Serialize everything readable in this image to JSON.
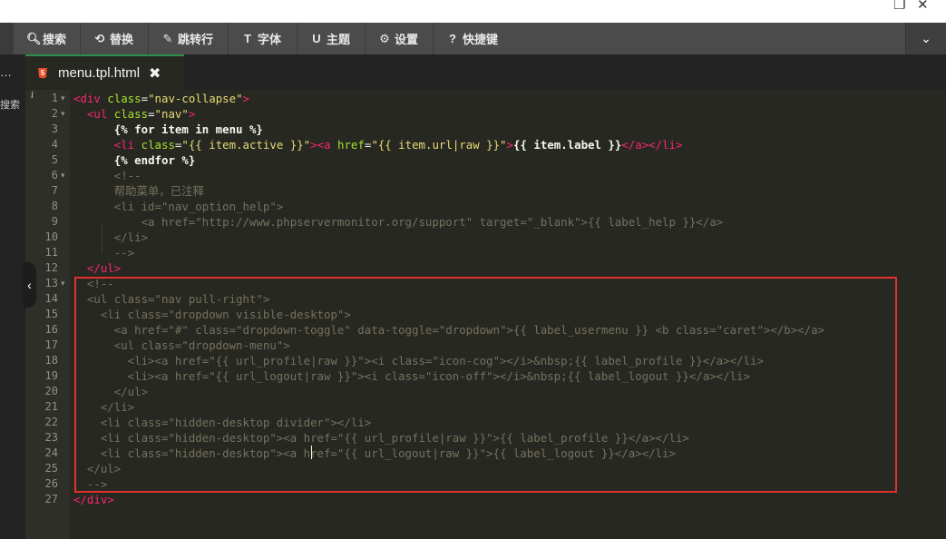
{
  "window": {
    "restore_icon": "restore-icon",
    "close_icon": "close-icon",
    "restore_glyph": "❐",
    "close_glyph": "✕"
  },
  "toolbar": {
    "items": [
      {
        "label": "搜索",
        "icon": "search-icon",
        "glyph": "🔍︎"
      },
      {
        "label": "替换",
        "icon": "replace-icon",
        "glyph": "⟲"
      },
      {
        "label": "跳转行",
        "icon": "pin-icon",
        "glyph": "✎"
      },
      {
        "label": "字体",
        "icon": "text-icon",
        "glyph": "T"
      },
      {
        "label": "主题",
        "icon": "magnet-icon",
        "glyph": "U"
      },
      {
        "label": "设置",
        "icon": "gear-icon",
        "glyph": "⚙"
      },
      {
        "label": "快捷键",
        "icon": "help-icon",
        "glyph": "?"
      }
    ],
    "collapse_glyph": "⌄"
  },
  "sidebar": {
    "dots": "…",
    "label": "搜索"
  },
  "tab": {
    "name": "menu.tpl.html",
    "close": "✖",
    "file_type_icon": "html5-icon"
  },
  "gutter": {
    "info": "i",
    "line_numbers": [
      "1",
      "2",
      "3",
      "4",
      "5",
      "6",
      "7",
      "8",
      "9",
      "10",
      "11",
      "12",
      "13",
      "14",
      "15",
      "16",
      "17",
      "18",
      "19",
      "20",
      "21",
      "22",
      "23",
      "24",
      "25",
      "26",
      "27"
    ],
    "fold_lines": [
      "1",
      "2",
      "6",
      "13"
    ]
  },
  "code": [
    [
      [
        "t",
        "<div "
      ],
      [
        "a",
        "class"
      ],
      [
        "p",
        "="
      ],
      [
        "s",
        "\"nav-collapse\""
      ],
      [
        "t",
        ">"
      ]
    ],
    [
      [
        "p",
        "  "
      ],
      [
        "t",
        "<ul "
      ],
      [
        "a",
        "class"
      ],
      [
        "p",
        "="
      ],
      [
        "s",
        "\"nav\""
      ],
      [
        "t",
        ">"
      ]
    ],
    [
      [
        "p",
        "      "
      ],
      [
        "tpl",
        "{% for item in menu %}"
      ]
    ],
    [
      [
        "p",
        "      "
      ],
      [
        "t",
        "<li "
      ],
      [
        "a",
        "class"
      ],
      [
        "p",
        "="
      ],
      [
        "s",
        "\"{{ item.active }}\""
      ],
      [
        "t",
        ">"
      ],
      [
        "t",
        "<a "
      ],
      [
        "a",
        "href"
      ],
      [
        "p",
        "="
      ],
      [
        "s",
        "\"{{ item.url|raw }}\""
      ],
      [
        "t",
        ">"
      ],
      [
        "tpl",
        "{{ item.label }}"
      ],
      [
        "t",
        "</a></li>"
      ]
    ],
    [
      [
        "p",
        "      "
      ],
      [
        "tpl",
        "{% endfor %}"
      ]
    ],
    [
      [
        "c",
        "      <!--"
      ]
    ],
    [
      [
        "c",
        "      帮助菜单，已注释"
      ]
    ],
    [
      [
        "c",
        "      <li id=\"nav_option_help\">"
      ]
    ],
    [
      [
        "c",
        "          <a href=\"http://www.phpservermonitor.org/support\" target=\"_blank\">{{ label_help }}</a>"
      ]
    ],
    [
      [
        "c",
        "      </li>"
      ]
    ],
    [
      [
        "c",
        "      -->"
      ]
    ],
    [
      [
        "p",
        "  "
      ],
      [
        "t",
        "</ul>"
      ]
    ],
    [
      [
        "c",
        "  <!--"
      ]
    ],
    [
      [
        "c",
        "  <ul class=\"nav pull-right\">"
      ]
    ],
    [
      [
        "c",
        "    <li class=\"dropdown visible-desktop\">"
      ]
    ],
    [
      [
        "c",
        "      <a href=\"#\" class=\"dropdown-toggle\" data-toggle=\"dropdown\">{{ label_usermenu }} <b class=\"caret\"></b></a>"
      ]
    ],
    [
      [
        "c",
        "      <ul class=\"dropdown-menu\">"
      ]
    ],
    [
      [
        "c",
        "        <li><a href=\"{{ url_profile|raw }}\"><i class=\"icon-cog\"></i>&nbsp;{{ label_profile }}</a></li>"
      ]
    ],
    [
      [
        "c",
        "        <li><a href=\"{{ url_logout|raw }}\"><i class=\"icon-off\"></i>&nbsp;{{ label_logout }}</a></li>"
      ]
    ],
    [
      [
        "c",
        "      </ul>"
      ]
    ],
    [
      [
        "c",
        "    </li>"
      ]
    ],
    [
      [
        "c",
        "    <li class=\"hidden-desktop divider\"></li>"
      ]
    ],
    [
      [
        "c",
        "    <li class=\"hidden-desktop\"><a href=\"{{ url_profile|raw }}\">{{ label_profile }}</a></li>"
      ]
    ],
    [
      [
        "c",
        "    <li class=\"hidden-desktop\"><a href=\"{{ url_logout|raw }}\">{{ label_logout }}</a></li>"
      ]
    ],
    [
      [
        "c",
        "  </ul>"
      ]
    ],
    [
      [
        "c",
        "  -->"
      ]
    ],
    [
      [
        "t",
        "</div>"
      ]
    ]
  ],
  "collapse_handle": "‹",
  "colors": {
    "highlight_box": "#e0312b",
    "tag": "#f92672",
    "attr": "#a6e22e",
    "string": "#e6db74",
    "comment": "#75715e"
  }
}
